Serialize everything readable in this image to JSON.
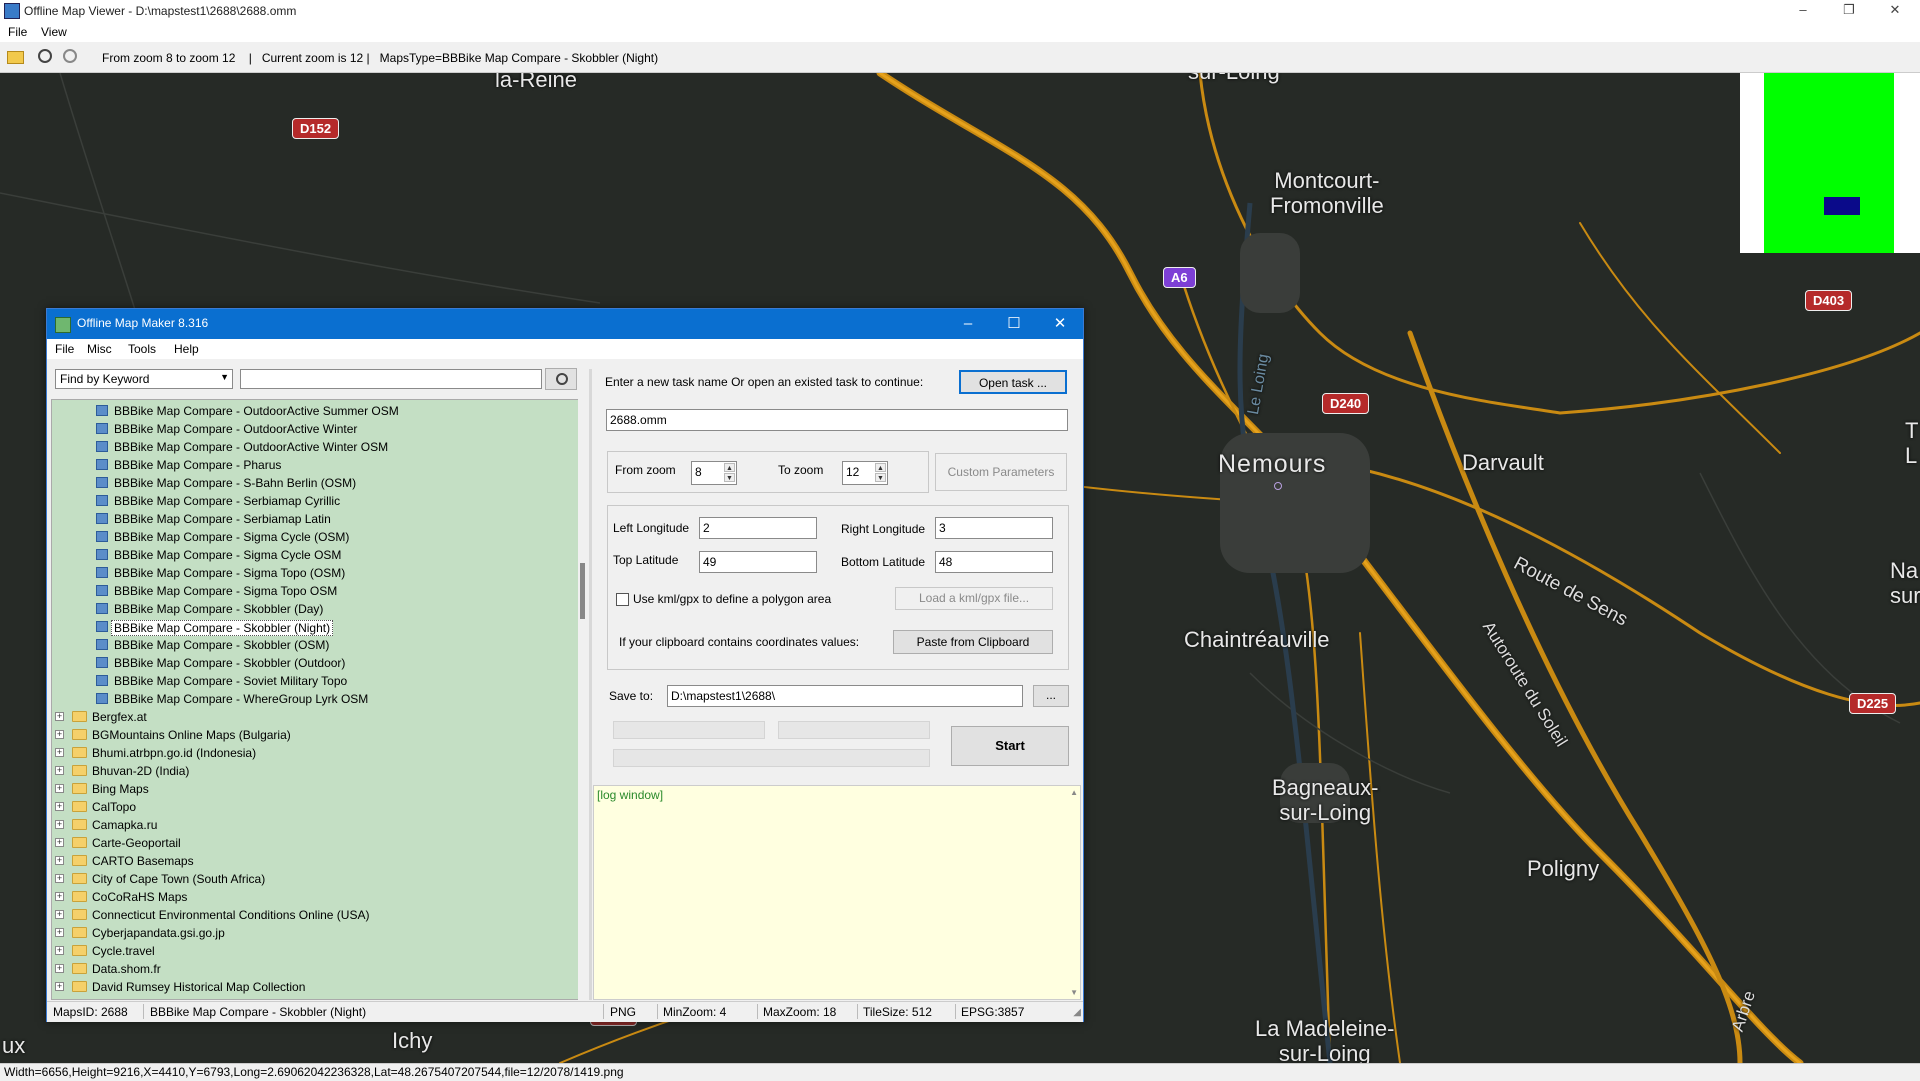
{
  "viewer": {
    "title": "Offline Map Viewer - D:\\mapstest1\\2688\\2688.omm",
    "menu": [
      "File",
      "View"
    ],
    "status_line": "From zoom 8 to zoom 12    |   Current zoom is 12 |   MapsType=BBBike Map Compare - Skobbler (Night)",
    "footer": "Width=6656,Height=9216,X=4410,Y=6793,Long=2.69062042236328,Lat=48.2675407207544,file=12/2078/1419.png"
  },
  "map": {
    "roads": [
      "D152",
      "A6",
      "D240",
      "D403",
      "D225",
      "D403"
    ],
    "places": [
      "la-Reine",
      "Montcourt-\nFromonville",
      "Nemours",
      "Darvault",
      "Chaintréauville",
      "Bagneaux-\nsur-Loing",
      "Poligny",
      "La Madeleine-\nsur-Loing",
      "Ichy",
      "ux",
      "Le Loing",
      "Route de Sens",
      "Autoroute du Soleil",
      "Arbre",
      "sur-Loing",
      "Na\nsur",
      "T\nL"
    ]
  },
  "dialog": {
    "title": "Offline Map Maker 8.316",
    "menu": [
      "File",
      "Misc",
      "Tools",
      "Help"
    ],
    "search": {
      "mode": "Find by Keyword",
      "value": ""
    },
    "tree_children": [
      "BBBike Map Compare - OutdoorActive Summer OSM",
      "BBBike Map Compare - OutdoorActive Winter",
      "BBBike Map Compare - OutdoorActive Winter OSM",
      "BBBike Map Compare - Pharus",
      "BBBike Map Compare - S-Bahn Berlin (OSM)",
      "BBBike Map Compare - Serbiamap Cyrillic",
      "BBBike Map Compare - Serbiamap Latin",
      "BBBike Map Compare - Sigma Cycle (OSM)",
      "BBBike Map Compare - Sigma Cycle OSM",
      "BBBike Map Compare - Sigma Topo (OSM)",
      "BBBike Map Compare - Sigma Topo OSM",
      "BBBike Map Compare - Skobbler (Day)",
      "BBBike Map Compare - Skobbler (Night)",
      "BBBike Map Compare - Skobbler (OSM)",
      "BBBike Map Compare - Skobbler (Outdoor)",
      "BBBike Map Compare - Soviet Military Topo",
      "BBBike Map Compare - WhereGroup Lyrk OSM"
    ],
    "tree_folders": [
      "Bergfex.at",
      "BGMountains Online Maps (Bulgaria)",
      "Bhumi.atrbpn.go.id (Indonesia)",
      "Bhuvan-2D (India)",
      "Bing Maps",
      "CalTopo",
      "Camapka.ru",
      "Carte-Geoportail",
      "CARTO Basemaps",
      "City of Cape Town (South Africa)",
      "CoCoRaHS Maps",
      "Connecticut Environmental Conditions Online (USA)",
      "Cyberjapandata.gsi.go.jp",
      "Cycle.travel",
      "Data.shom.fr",
      "David Rumsey Historical Map Collection"
    ],
    "selected_item": "BBBike Map Compare - Skobbler (Night)",
    "task_prompt": "Enter a new task name Or open an existed task to continue:",
    "open_task_label": "Open task ...",
    "task_name": "2688.omm",
    "from_zoom_label": "From zoom",
    "from_zoom": "8",
    "to_zoom_label": "To zoom",
    "to_zoom": "12",
    "custom_params_label": "Custom Parameters",
    "left_lon_label": "Left Longitude",
    "left_lon": "2",
    "right_lon_label": "Right Longitude",
    "right_lon": "3",
    "top_lat_label": "Top Latitude",
    "top_lat": "49",
    "bottom_lat_label": "Bottom Latitude",
    "bottom_lat": "48",
    "kml_label": "Use kml/gpx to define a polygon area",
    "load_kml_label": "Load a kml/gpx file...",
    "clipboard_prompt": "If your clipboard contains coordinates values:",
    "paste_label": "Paste from Clipboard",
    "save_to_label": "Save to:",
    "save_to": "D:\\mapstest1\\2688\\",
    "browse_label": "...",
    "start_label": "Start",
    "log_text": "[log window]",
    "status": {
      "maps_id": "MapsID: 2688",
      "maps_name": "BBBike Map Compare - Skobbler (Night)",
      "format": "PNG",
      "min_zoom": "MinZoom: 4",
      "max_zoom": "MaxZoom: 18",
      "tile_size": "TileSize: 512",
      "epsg": "EPSG:3857"
    }
  },
  "colors": {
    "map_bg": "#262a26",
    "road_orange": "#c98a12",
    "tree_bg": "#c4dfc4",
    "log_bg": "#ffffe0",
    "title_blue": "#0a6fd0",
    "minimap_green": "#00ff00",
    "minimap_marker": "#0a0a8a"
  }
}
